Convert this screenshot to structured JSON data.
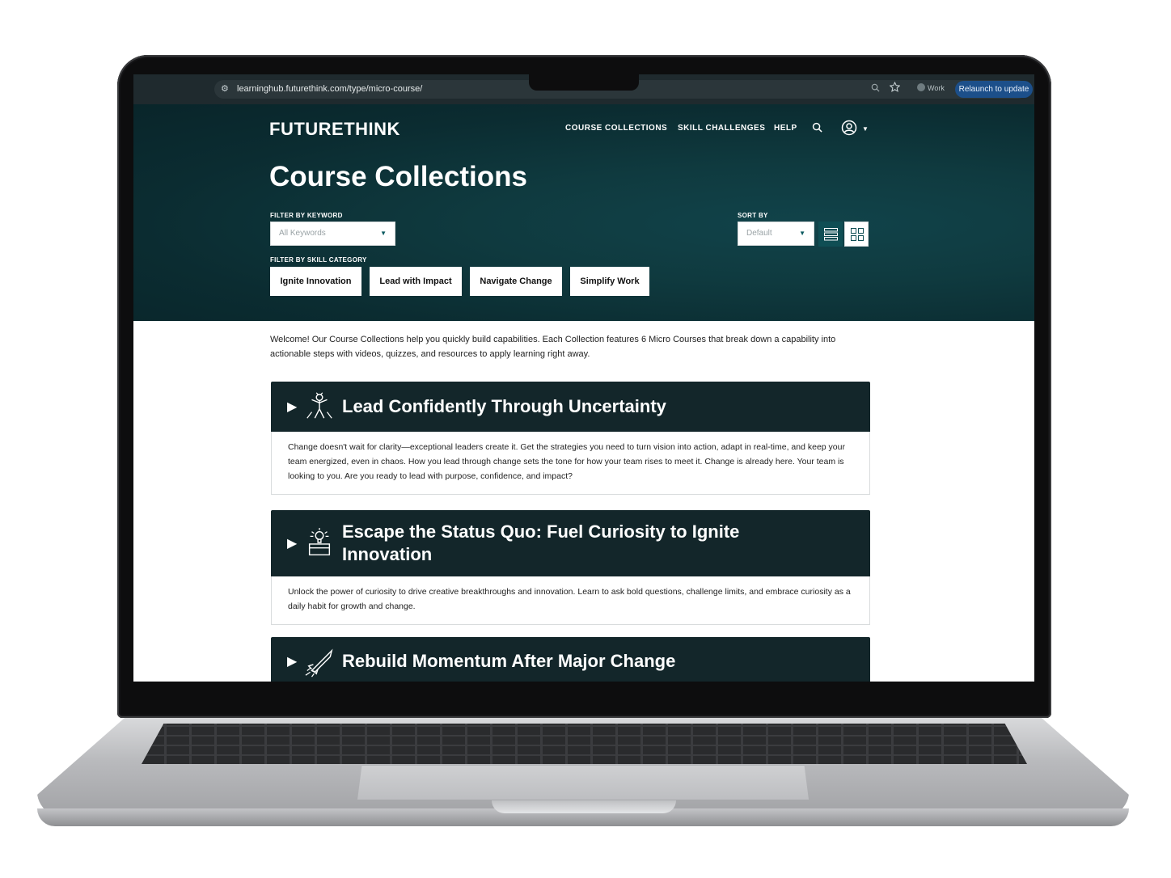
{
  "browser": {
    "url": "learninghub.futurethink.com/type/micro-course/",
    "profile_label": "Work",
    "relaunch_label": "Relaunch to update"
  },
  "header": {
    "logo": "FUTURETHINK",
    "nav": [
      "COURSE COLLECTIONS",
      "SKILL CHALLENGES",
      "HELP"
    ],
    "icons": [
      "search-icon",
      "user-account-icon",
      "chevron-down-icon"
    ]
  },
  "page": {
    "title": "Course Collections",
    "filter_keyword_label": "FILTER BY KEYWORD",
    "keyword_value": "All Keywords",
    "sort_label": "SORT BY",
    "sort_value": "Default",
    "filter_category_label": "FILTER BY SKILL CATEGORY",
    "categories": [
      "Ignite Innovation",
      "Lead with Impact",
      "Navigate Change",
      "Simplify Work"
    ],
    "view_modes": [
      "list",
      "grid"
    ],
    "active_view": "list"
  },
  "intro": "Welcome! Our Course Collections help you quickly build capabilities. Each Collection features 6 Micro Courses that break down a capability into actionable steps with videos, quizzes, and resources to apply learning right away.",
  "collections": [
    {
      "title": "Lead Confidently Through Uncertainty",
      "icon": "leader-icon",
      "description": "Change doesn't wait for clarity—exceptional leaders create it. Get the strategies you need to turn vision into action, adapt in real-time, and keep your team energized, even in chaos. How you lead through change sets the tone for how your team rises to meet it. Change is already here. Your team is looking to you. Are you ready to lead with purpose, confidence, and impact?"
    },
    {
      "title": "Escape the Status Quo: Fuel Curiosity to Ignite Innovation",
      "icon": "idea-box-icon",
      "description": "Unlock the power of curiosity to drive creative breakthroughs and innovation. Learn to ask bold questions, challenge limits, and embrace curiosity as a daily habit for growth and change."
    },
    {
      "title": "Rebuild Momentum After Major Change",
      "icon": "rocket-icon",
      "description": ""
    }
  ],
  "colors": {
    "hero_bg": "#0b2c31",
    "card_header": "#13262a",
    "active_view": "#0f4e54",
    "relaunch": "#1c4f8a"
  }
}
